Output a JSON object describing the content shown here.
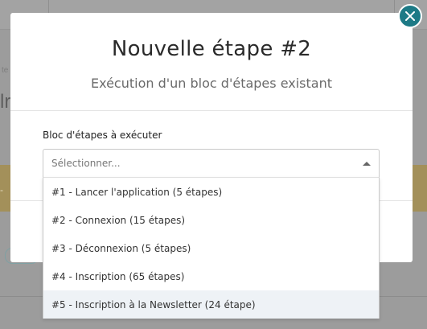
{
  "background": {
    "crumb_fragment": "te",
    "big_fragment": "lr",
    "banner_fragment": "-"
  },
  "modal": {
    "title": "Nouvelle étape #2",
    "subtitle": "Exécution d'un bloc d'étapes existant",
    "close_icon": "close-icon"
  },
  "field": {
    "label": "Bloc d'étapes à exécuter",
    "placeholder": "Sélectionner...",
    "options": [
      "#1 - Lancer l'application (5 étapes)",
      "#2 - Connexion (15 étapes)",
      "#3 - Déconnexion (5 étapes)",
      "#4 - Inscription (65 étapes)",
      "#5 - Inscription à la Newsletter (24 étape)"
    ],
    "highlighted_index": 4
  },
  "colors": {
    "accent": "#1d7a86",
    "highlight": "#eef2f6"
  }
}
